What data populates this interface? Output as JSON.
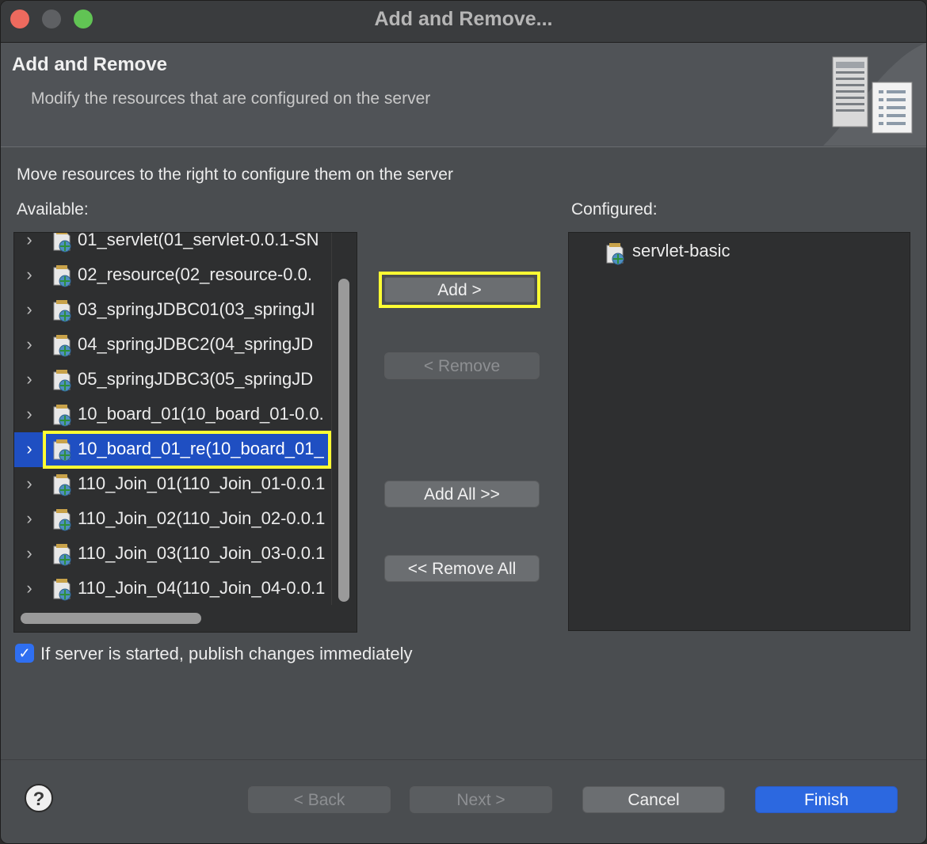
{
  "window": {
    "title": "Add and Remove..."
  },
  "header": {
    "title": "Add and Remove",
    "subtitle": "Modify the resources that are configured on the server"
  },
  "instruction": "Move resources to the right to configure them on the server",
  "available": {
    "label": "Available:",
    "items": [
      {
        "label": "01_servlet(01_servlet-0.0.1-SN"
      },
      {
        "label": "02_resource(02_resource-0.0."
      },
      {
        "label": "03_springJDBC01(03_springJI"
      },
      {
        "label": "04_springJDBC2(04_springJD"
      },
      {
        "label": "05_springJDBC3(05_springJD"
      },
      {
        "label": "10_board_01(10_board_01-0.0."
      },
      {
        "label": "10_board_01_re(10_board_01_"
      },
      {
        "label": "110_Join_01(110_Join_01-0.0.1"
      },
      {
        "label": "110_Join_02(110_Join_02-0.0.1"
      },
      {
        "label": "110_Join_03(110_Join_03-0.0.1"
      },
      {
        "label": "110_Join_04(110_Join_04-0.0.1"
      }
    ],
    "selected_index": 6
  },
  "configured": {
    "label": "Configured:",
    "items": [
      {
        "label": "servlet-basic"
      }
    ]
  },
  "buttons": {
    "add": "Add >",
    "remove": "< Remove",
    "add_all": "Add All >>",
    "remove_all": "<< Remove All"
  },
  "publish_checkbox": {
    "label": "If server is started, publish changes immediately",
    "checked": true
  },
  "footer": {
    "help": "?",
    "back": "< Back",
    "next": "Next >",
    "cancel": "Cancel",
    "finish": "Finish"
  },
  "colors": {
    "selection": "#1f4fc2",
    "highlight_box": "#ffff33",
    "finish_button": "#2c68e0",
    "close_light": "#ed6a5e",
    "maximize_light": "#61c454"
  }
}
